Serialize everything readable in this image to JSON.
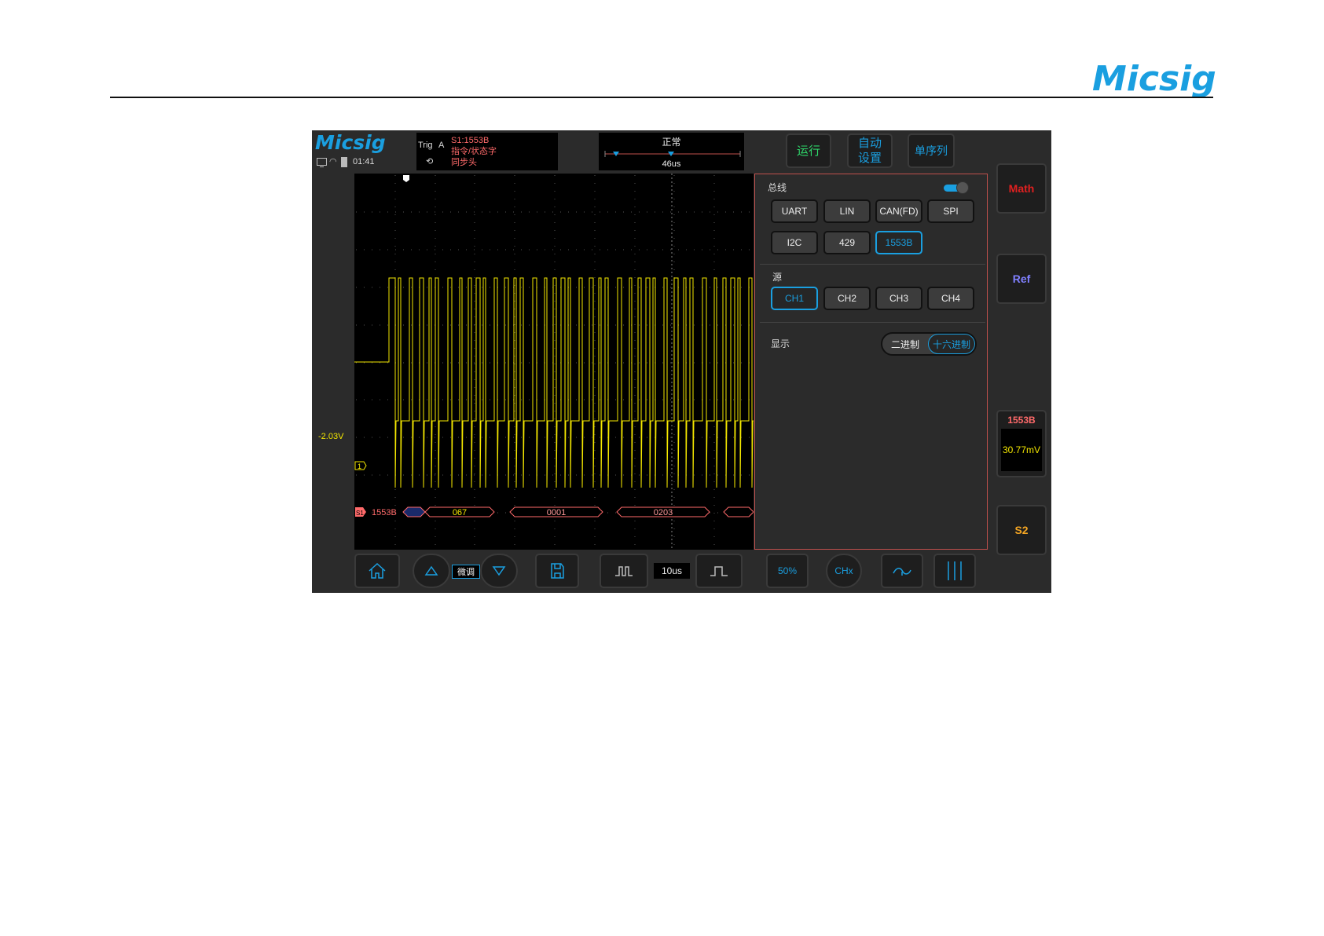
{
  "header": {
    "logo_text": "Micsig"
  },
  "scope": {
    "logo_text": "Micsig",
    "time": "01:41",
    "trigger": {
      "label": "Trig",
      "source": "A",
      "lines": [
        "S1:1553B",
        "指令/状态字",
        "同步头"
      ]
    },
    "timebase": {
      "mode": "正常",
      "position": "46us"
    },
    "top_buttons": {
      "run": "运行",
      "auto_line1": "自动",
      "auto_line2": "设置",
      "single": "单序列"
    },
    "side_buttons": {
      "math": "Math",
      "ref": "Ref",
      "bus_title": "1553B",
      "bus_value": "30.77mV",
      "s2": "S2"
    },
    "channel_scale": "-2.03V",
    "channel_marker": "1",
    "bus_label": "1553B",
    "bus_marker": "S1",
    "decode_words": [
      "067",
      "0001",
      "0203"
    ],
    "bottom": {
      "fine": "微调",
      "timebase_value": "10us",
      "percent": "50%",
      "ch": "CHx"
    }
  },
  "panel": {
    "bus_title": "总线",
    "bus_types": [
      "UART",
      "LIN",
      "CAN(FD)",
      "SPI",
      "I2C",
      "429",
      "1553B"
    ],
    "bus_selected": "1553B",
    "source_title": "源",
    "sources": [
      "CH1",
      "CH2",
      "CH3",
      "CH4"
    ],
    "source_selected": "CH1",
    "display_title": "显示",
    "display_options": [
      "二进制",
      "十六进制"
    ],
    "display_selected": "十六进制"
  },
  "colors": {
    "accent": "#1a9fe0",
    "trace": "#f5e800",
    "bus": "#ff6a6a",
    "run": "#2fd86b"
  }
}
